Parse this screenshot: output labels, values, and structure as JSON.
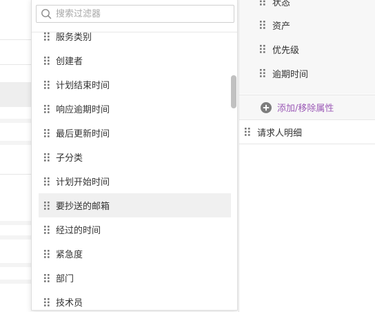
{
  "filter_dropdown": {
    "search_placeholder": "搜索过滤器",
    "items": [
      {
        "label": "服务类别"
      },
      {
        "label": "创建者"
      },
      {
        "label": "计划结束时间"
      },
      {
        "label": "响应逾期时间"
      },
      {
        "label": "最后更新时间"
      },
      {
        "label": "子分类"
      },
      {
        "label": "计划开始时间"
      },
      {
        "label": "要抄送的邮箱"
      },
      {
        "label": "经过的时间"
      },
      {
        "label": "紧急度"
      },
      {
        "label": "部门"
      },
      {
        "label": "技术员"
      }
    ],
    "highlighted_item": "要抄送的邮箱"
  },
  "properties_panel": {
    "items": [
      {
        "label": "状态"
      },
      {
        "label": "资产"
      },
      {
        "label": "优先级"
      },
      {
        "label": "逾期时间"
      }
    ],
    "add_remove_label": "添加/移除属性",
    "detail_row_label": "请求人明细"
  },
  "colors": {
    "accent": "#9b59b6",
    "text": "#333333",
    "placeholder": "#a8a8a8",
    "highlight_bg": "#f0f0f0",
    "panel_bg": "#f7f7f7"
  },
  "icons": {
    "search": "search-icon",
    "drag_handle": "drag-handle-icon",
    "add": "plus-circle-icon"
  }
}
